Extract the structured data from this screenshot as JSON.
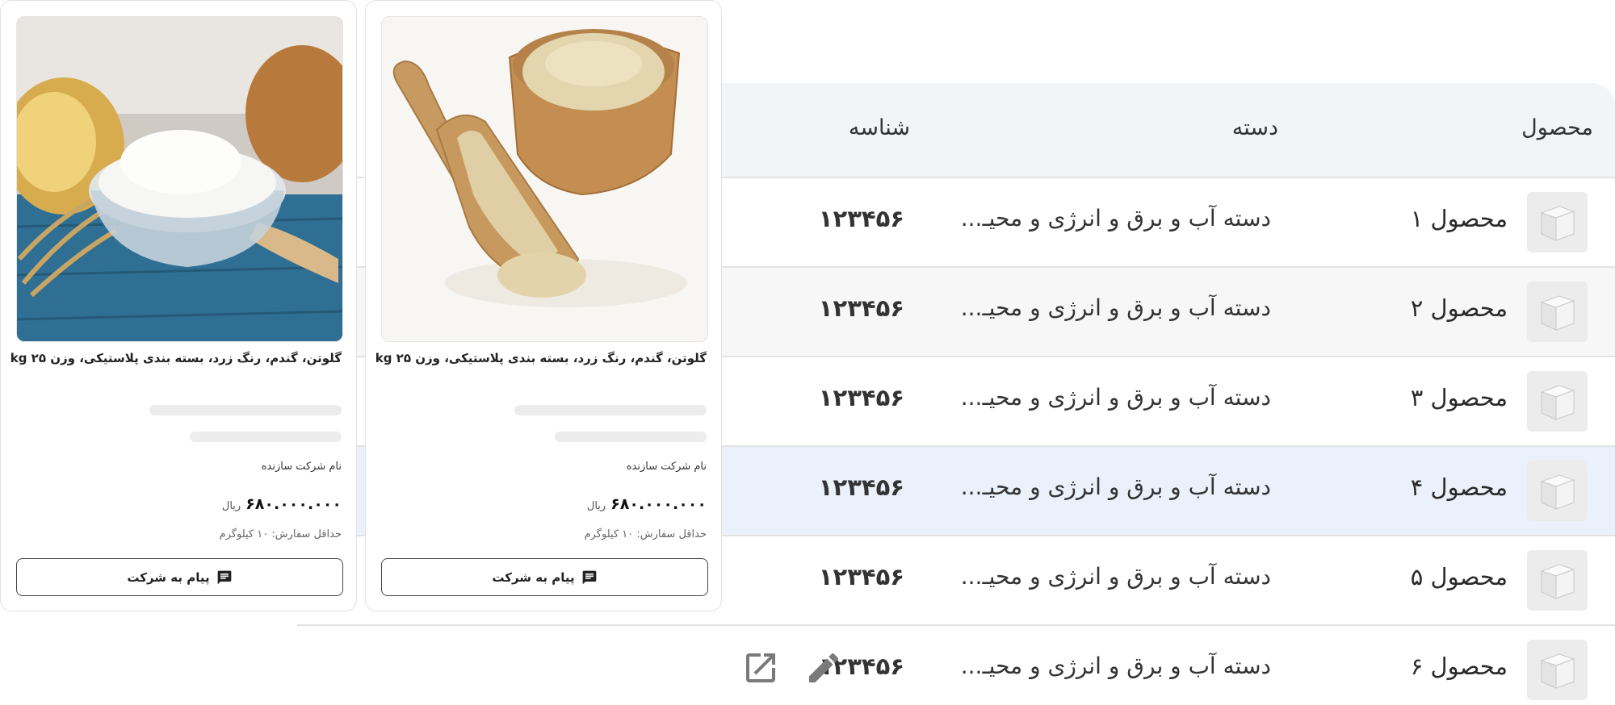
{
  "table": {
    "headers": {
      "product": "محصول",
      "category": "دسته",
      "id": "شناسه"
    },
    "rows": [
      {
        "name": "محصول ۱",
        "category": "دسته آب و برق و انرژی و محیـ...",
        "id": "۱۲۳۴۵۶"
      },
      {
        "name": "محصول ۲",
        "category": "دسته آب و برق و انرژی و محیـ...",
        "id": "۱۲۳۴۵۶"
      },
      {
        "name": "محصول ۳",
        "category": "دسته آب و برق و انرژی و محیـ...",
        "id": "۱۲۳۴۵۶"
      },
      {
        "name": "محصول ۴",
        "category": "دسته آب و برق و انرژی و محیـ...",
        "id": "۱۲۳۴۵۶"
      },
      {
        "name": "محصول ۵",
        "category": "دسته آب و برق و انرژی و محیـ...",
        "id": "۱۲۳۴۵۶"
      },
      {
        "name": "محصول ۶",
        "category": "دسته آب و برق و انرژی و محیـ...",
        "id": "۱۲۳۴۵۶"
      }
    ],
    "row_actions": [
      "edit-icon",
      "open-external-icon"
    ]
  },
  "cards": [
    {
      "image": "wooden-bowl-and-scoop-flour-photo",
      "title": "گلوتن، گندم، رنگ زرد، بسته بندی پلاستیکی، وزن kg ۲۵",
      "maker": "نام شرکت سازنده",
      "price": "۶۸۰.۰۰۰.۰۰۰",
      "currency": "ریال",
      "min_order": "حداقل سفارش: ۱۰ کیلوگرم",
      "button_label": "پیام به شرکت",
      "button_icon": "message-icon"
    },
    {
      "image": "glass-bowl-potato-starch-photo",
      "title": "گلوتن، گندم، رنگ زرد، بسته بندی پلاستیکی، وزن kg ۲۵",
      "maker": "نام شرکت سازنده",
      "price": "۶۸۰.۰۰۰.۰۰۰",
      "currency": "ریال",
      "min_order": "حداقل سفارش: ۱۰ کیلوگرم",
      "button_label": "پیام به شرکت",
      "button_icon": "message-icon"
    }
  ],
  "colors": {
    "header_bg": "#f2f4f7",
    "row_alt": "#f7f7f7",
    "row_highlight": "#ebf1fb"
  }
}
